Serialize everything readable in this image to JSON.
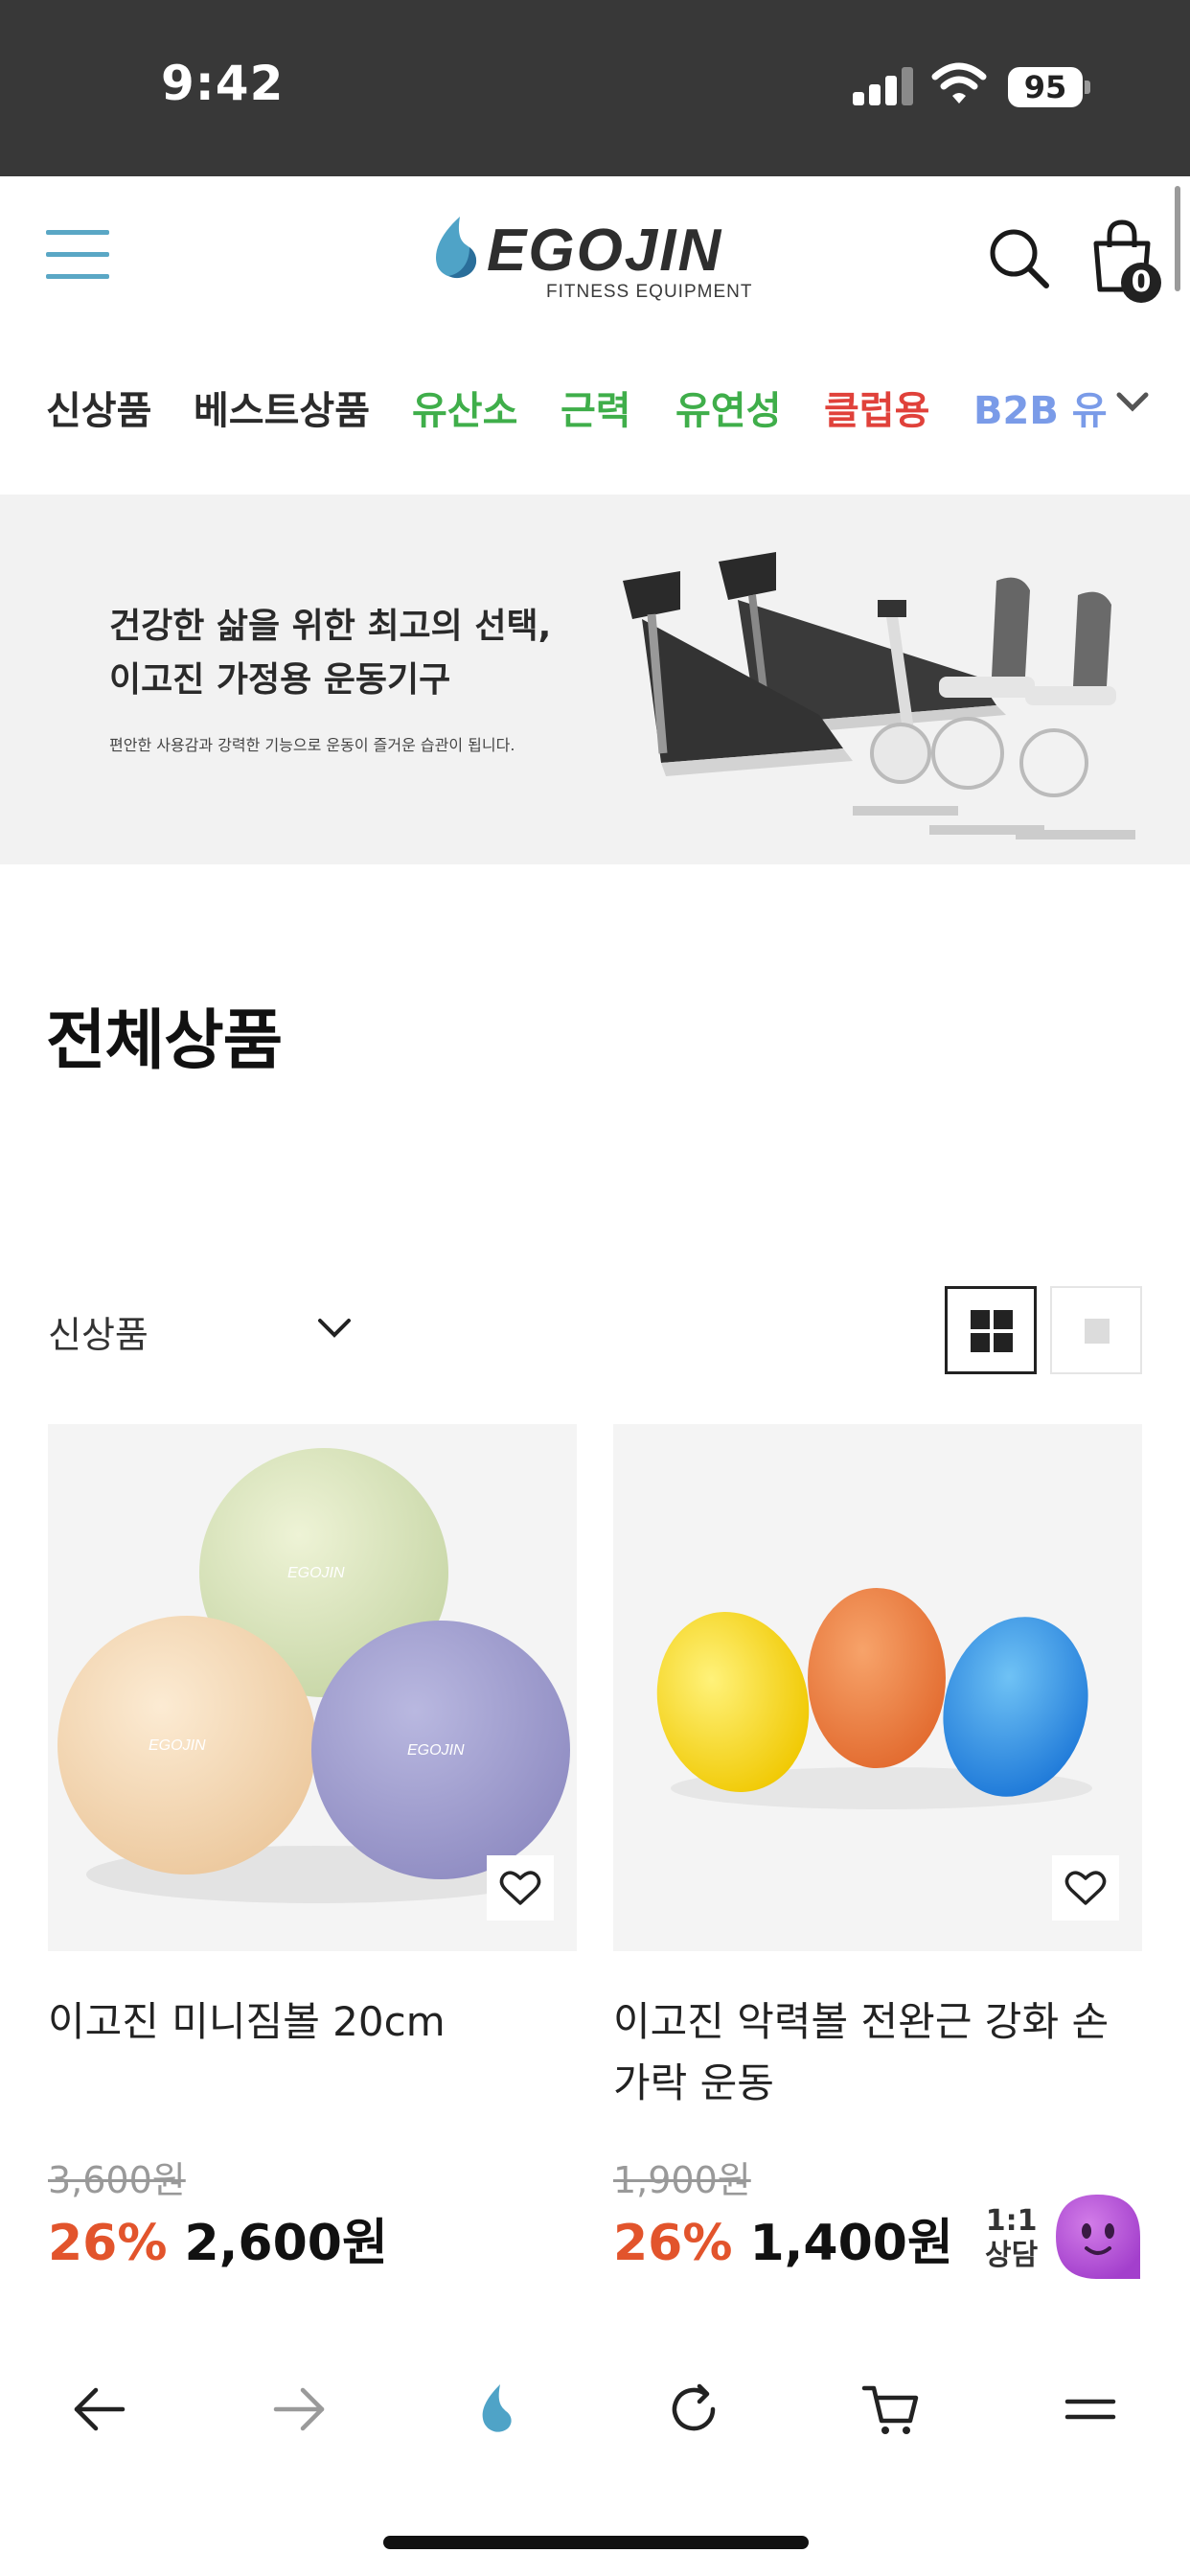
{
  "status_bar": {
    "time": "9:42",
    "battery": "95"
  },
  "header": {
    "logo_text": "EGOJIN",
    "logo_sub": "FITNESS EQUIPMENT",
    "cart_count": "0"
  },
  "categories": [
    {
      "label": "신상품",
      "color": "#2b2b2b"
    },
    {
      "label": "베스트상품",
      "color": "#2b2b2b"
    },
    {
      "label": "유산소",
      "color": "#3fae4a"
    },
    {
      "label": "근력",
      "color": "#3fae4a"
    },
    {
      "label": "유연성",
      "color": "#3fae4a"
    },
    {
      "label": "클럽용",
      "color": "#e0413a"
    },
    {
      "label": "B2B 유",
      "color": "#7a9be8"
    }
  ],
  "banner": {
    "title_line1": "건강한 삶을 위한 최고의 선택,",
    "title_line2": "이고진 가정용 운동기구",
    "subtitle": "편안한 사용감과 강력한 기능으로 운동이 즐거운 습관이 됩니다."
  },
  "section_title": "전체상품",
  "sort": {
    "selected": "신상품"
  },
  "products": [
    {
      "name": "이고진 미니짐볼 20cm",
      "original_price": "3,600원",
      "discount": "26%",
      "sale_price": "2,600원"
    },
    {
      "name": "이고진 악력볼 전완근 강화 손가락 운동",
      "original_price": "1,900원",
      "discount": "26%",
      "sale_price": "1,400원"
    }
  ],
  "chat": {
    "label_line1": "1:1",
    "label_line2": "상담"
  },
  "colors": {
    "accent": "#5aa7c5",
    "discount": "#e2542c",
    "status_bar": "#383838",
    "chat": "#b04fd6"
  }
}
